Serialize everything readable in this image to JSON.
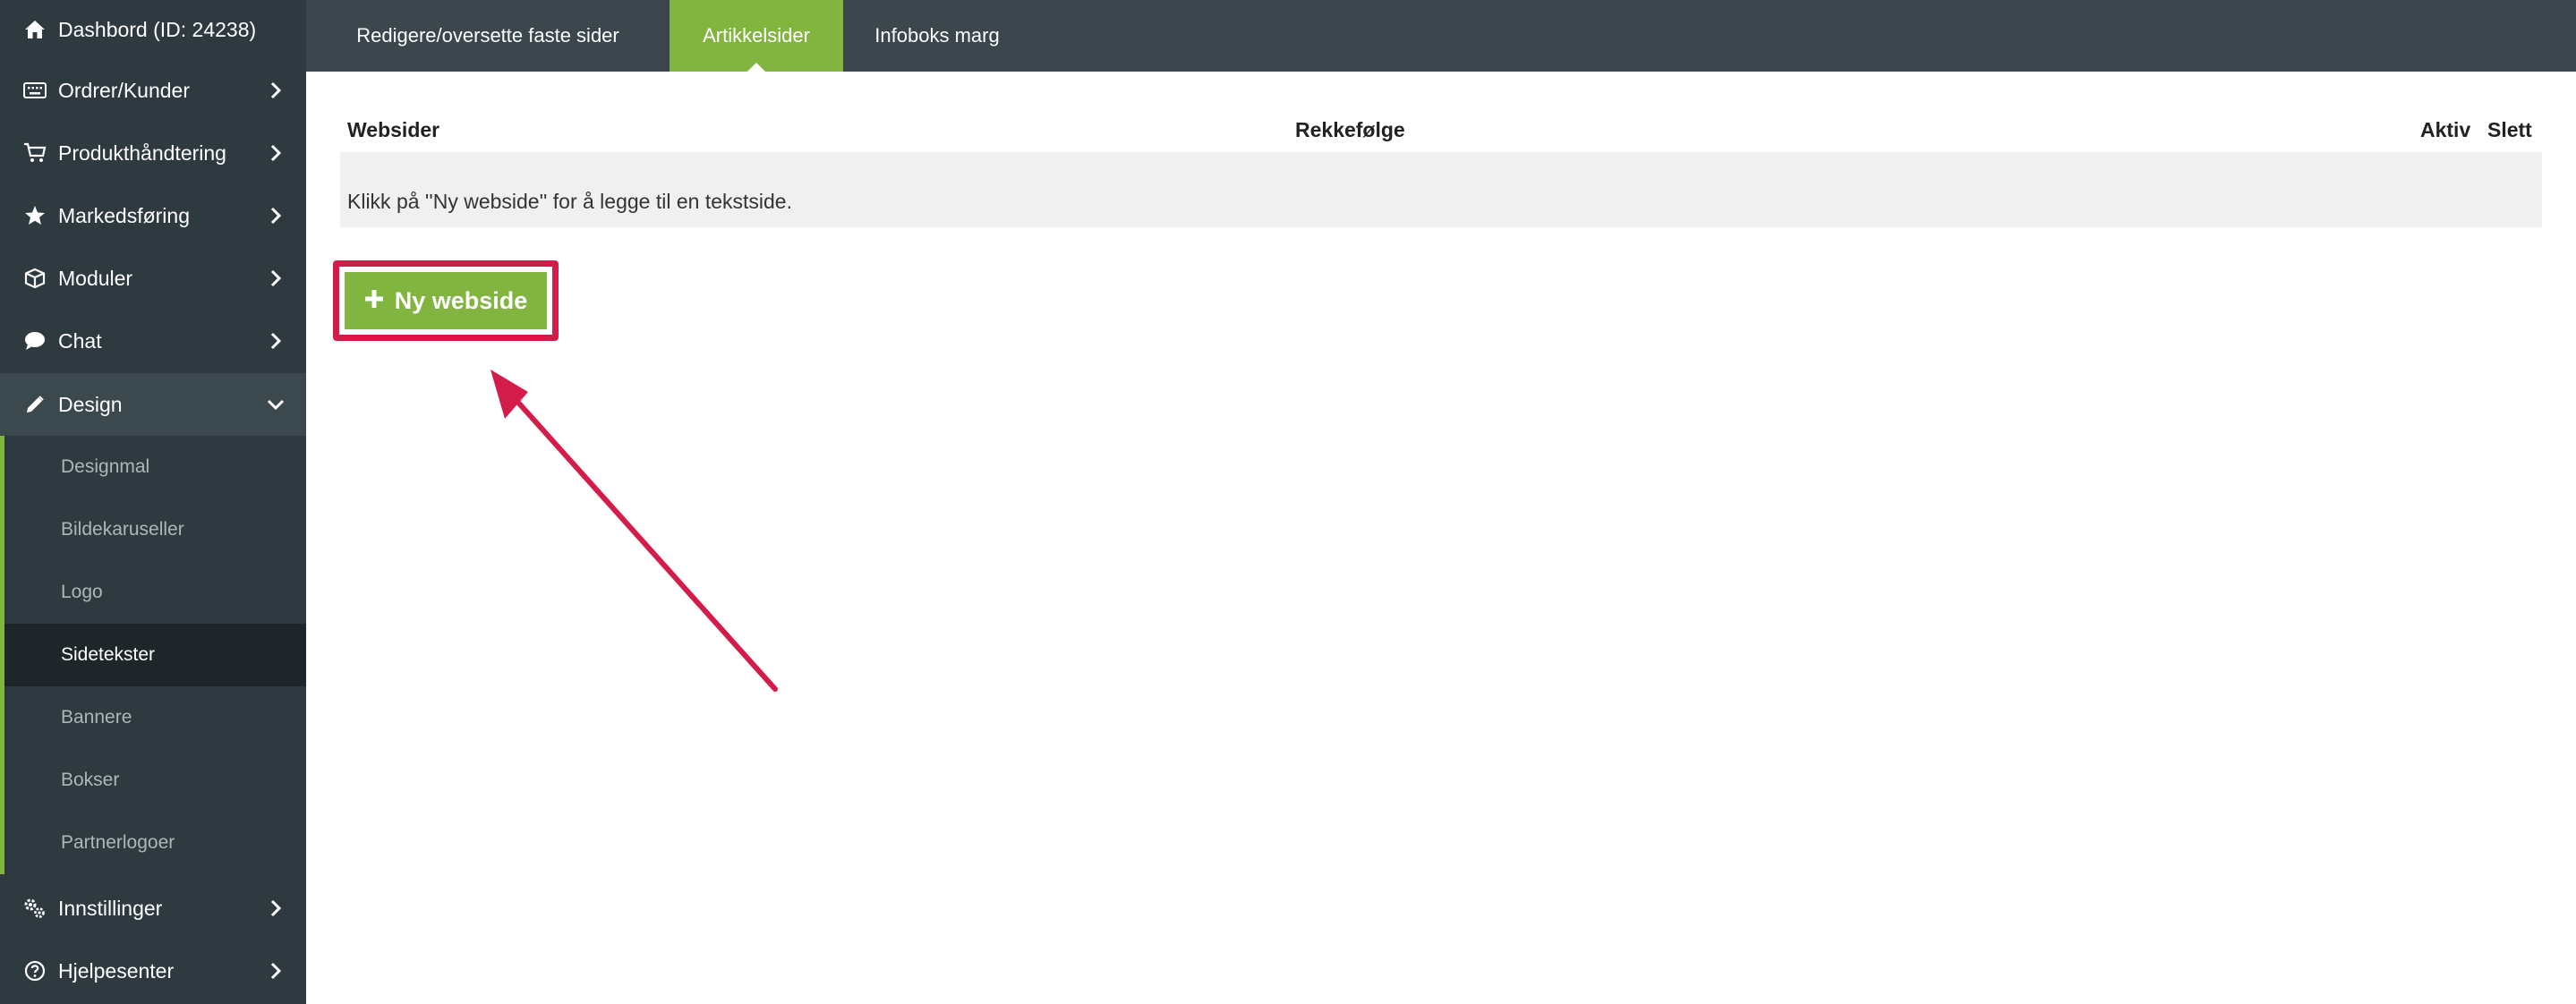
{
  "sidebar": {
    "items": [
      {
        "label": "Dashbord (ID: 24238)",
        "icon": "home-icon"
      },
      {
        "label": "Ordrer/Kunder",
        "icon": "keyboard-icon"
      },
      {
        "label": "Produkthåndtering",
        "icon": "cart-icon"
      },
      {
        "label": "Markedsføring",
        "icon": "star-icon"
      },
      {
        "label": "Moduler",
        "icon": "cube-icon"
      },
      {
        "label": "Chat",
        "icon": "chat-bubble-icon"
      },
      {
        "label": "Design",
        "icon": "pencil-icon"
      },
      {
        "label": "Innstillinger",
        "icon": "gears-icon"
      },
      {
        "label": "Hjelpesenter",
        "icon": "question-circle-icon"
      }
    ],
    "design_subitems": [
      "Designmal",
      "Bildekaruseller",
      "Logo",
      "Sidetekster",
      "Bannere",
      "Bokser",
      "Partnerlogoer"
    ],
    "selected_subitem": "Sidetekster"
  },
  "tabs": [
    {
      "label": "Redigere/oversette faste sider",
      "active": false
    },
    {
      "label": "Artikkelsider",
      "active": true
    },
    {
      "label": "Infoboks marg",
      "active": false
    }
  ],
  "table": {
    "headers": {
      "websider": "Websider",
      "rekkefolge": "Rekkefølge",
      "aktiv": "Aktiv",
      "slett": "Slett"
    },
    "empty_message": "Klikk på ''Ny webside'' for å legge til en tekstside."
  },
  "new_button": {
    "icon": "plus-icon",
    "label": "Ny webside"
  },
  "colors": {
    "sidebar_bg": "#2e3a3f",
    "topbar_bg": "#3b474c",
    "accent_green": "#82b440",
    "highlight_red": "#d41c4a"
  }
}
